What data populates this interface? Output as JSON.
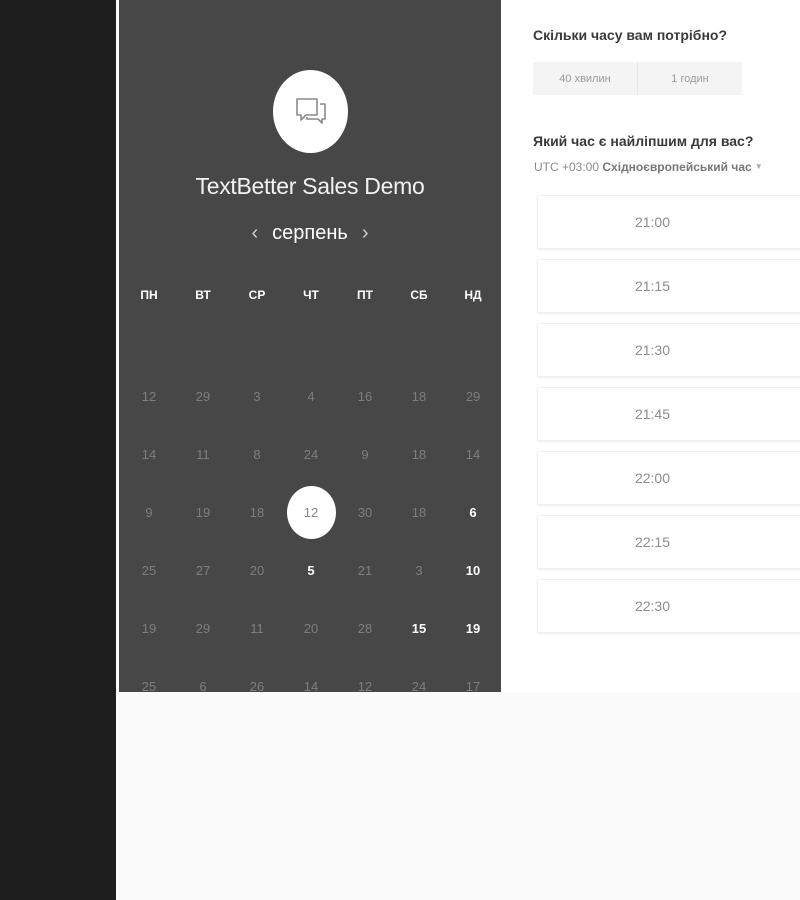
{
  "calendar": {
    "title": "TextBetter Sales Demo",
    "month": "серпень",
    "prev_icon": "‹",
    "next_icon": "›",
    "weekdays": [
      "ПН",
      "ВТ",
      "СР",
      "ЧТ",
      "ПТ",
      "СБ",
      "НД"
    ],
    "weeks": [
      [
        "12",
        "29",
        "3",
        "4",
        "16",
        "18",
        "29"
      ],
      [
        "14",
        "11",
        "8",
        "24",
        "9",
        "18",
        "14"
      ],
      [
        "9",
        "19",
        "18",
        "12",
        "30",
        "18",
        "6"
      ],
      [
        "25",
        "27",
        "20",
        "5",
        "21",
        "3",
        "10"
      ],
      [
        "19",
        "29",
        "11",
        "20",
        "28",
        "15",
        "19"
      ],
      [
        "25",
        "6",
        "26",
        "14",
        "12",
        "24",
        "17"
      ]
    ]
  },
  "booking": {
    "duration_question": "Скільки часу вам потрібно?",
    "durations": [
      "40 хвилин",
      "1 годин"
    ],
    "time_question": "Який час є найліпшим для вас?",
    "timezone_offset": "UTC +03:00",
    "timezone_name": "Східноєвропейський час",
    "slots": [
      "21:00",
      "21:15",
      "21:30",
      "21:45",
      "22:00",
      "22:15",
      "22:30"
    ]
  }
}
